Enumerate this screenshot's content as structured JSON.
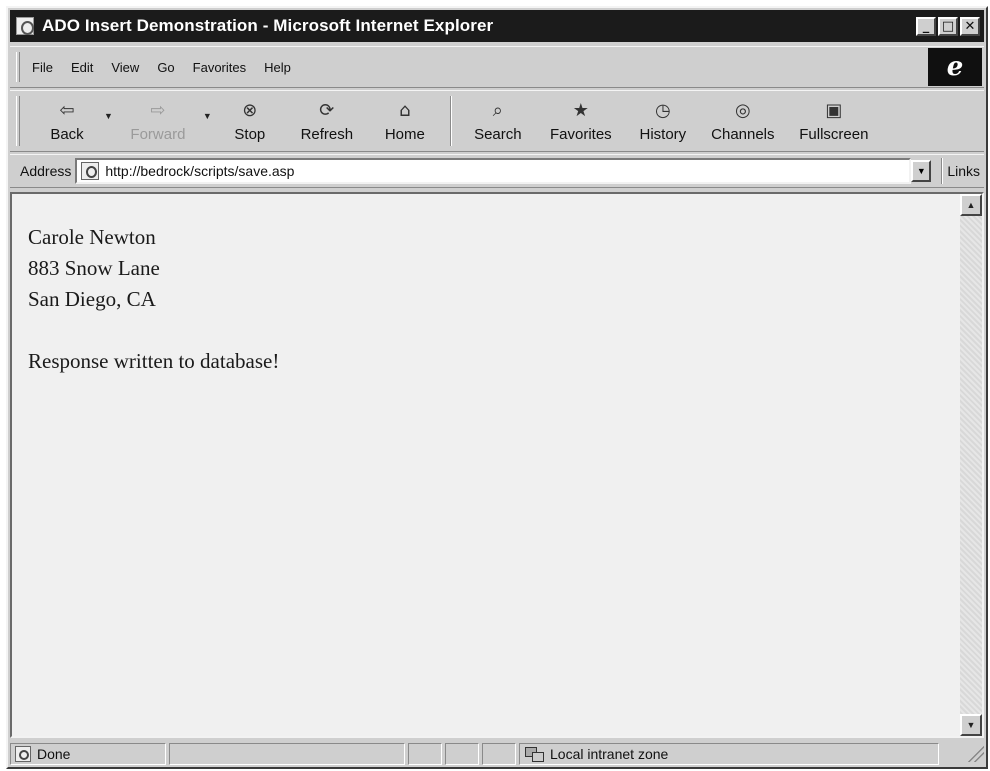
{
  "window": {
    "title": "ADO Insert Demonstration - Microsoft Internet Explorer"
  },
  "title_buttons": {
    "minimize": "_",
    "maximize": "□",
    "close": "✕"
  },
  "menu": [
    "File",
    "Edit",
    "View",
    "Go",
    "Favorites",
    "Help"
  ],
  "toolbar": {
    "back": "Back",
    "forward": "Forward",
    "stop": "Stop",
    "refresh": "Refresh",
    "home": "Home",
    "search": "Search",
    "favorites": "Favorites",
    "history": "History",
    "channels": "Channels",
    "fullscreen": "Fullscreen",
    "icons": {
      "back": "⇦",
      "forward": "⇨",
      "stop": "⊗",
      "refresh": "⟳",
      "home": "⌂",
      "search": "⌕",
      "favorites": "★",
      "history": "◷",
      "channels": "◎",
      "fullscreen": "▣",
      "dropdown": "▼"
    }
  },
  "address": {
    "label": "Address",
    "url": "http://bedrock/scripts/save.asp",
    "links": "Links"
  },
  "content": {
    "lines": [
      "Carole Newton",
      "883 Snow Lane",
      "San Diego, CA"
    ],
    "message": "Response written to database!"
  },
  "status": {
    "text": "Done",
    "zone": "Local intranet zone"
  },
  "icon_names": [
    "ie-page-icon",
    "ie-logo-icon",
    "back-arrow-icon",
    "forward-arrow-icon",
    "stop-icon",
    "refresh-icon",
    "home-icon",
    "search-icon",
    "favorites-icon",
    "history-icon",
    "channels-icon",
    "fullscreen-icon",
    "local-intranet-icon"
  ]
}
